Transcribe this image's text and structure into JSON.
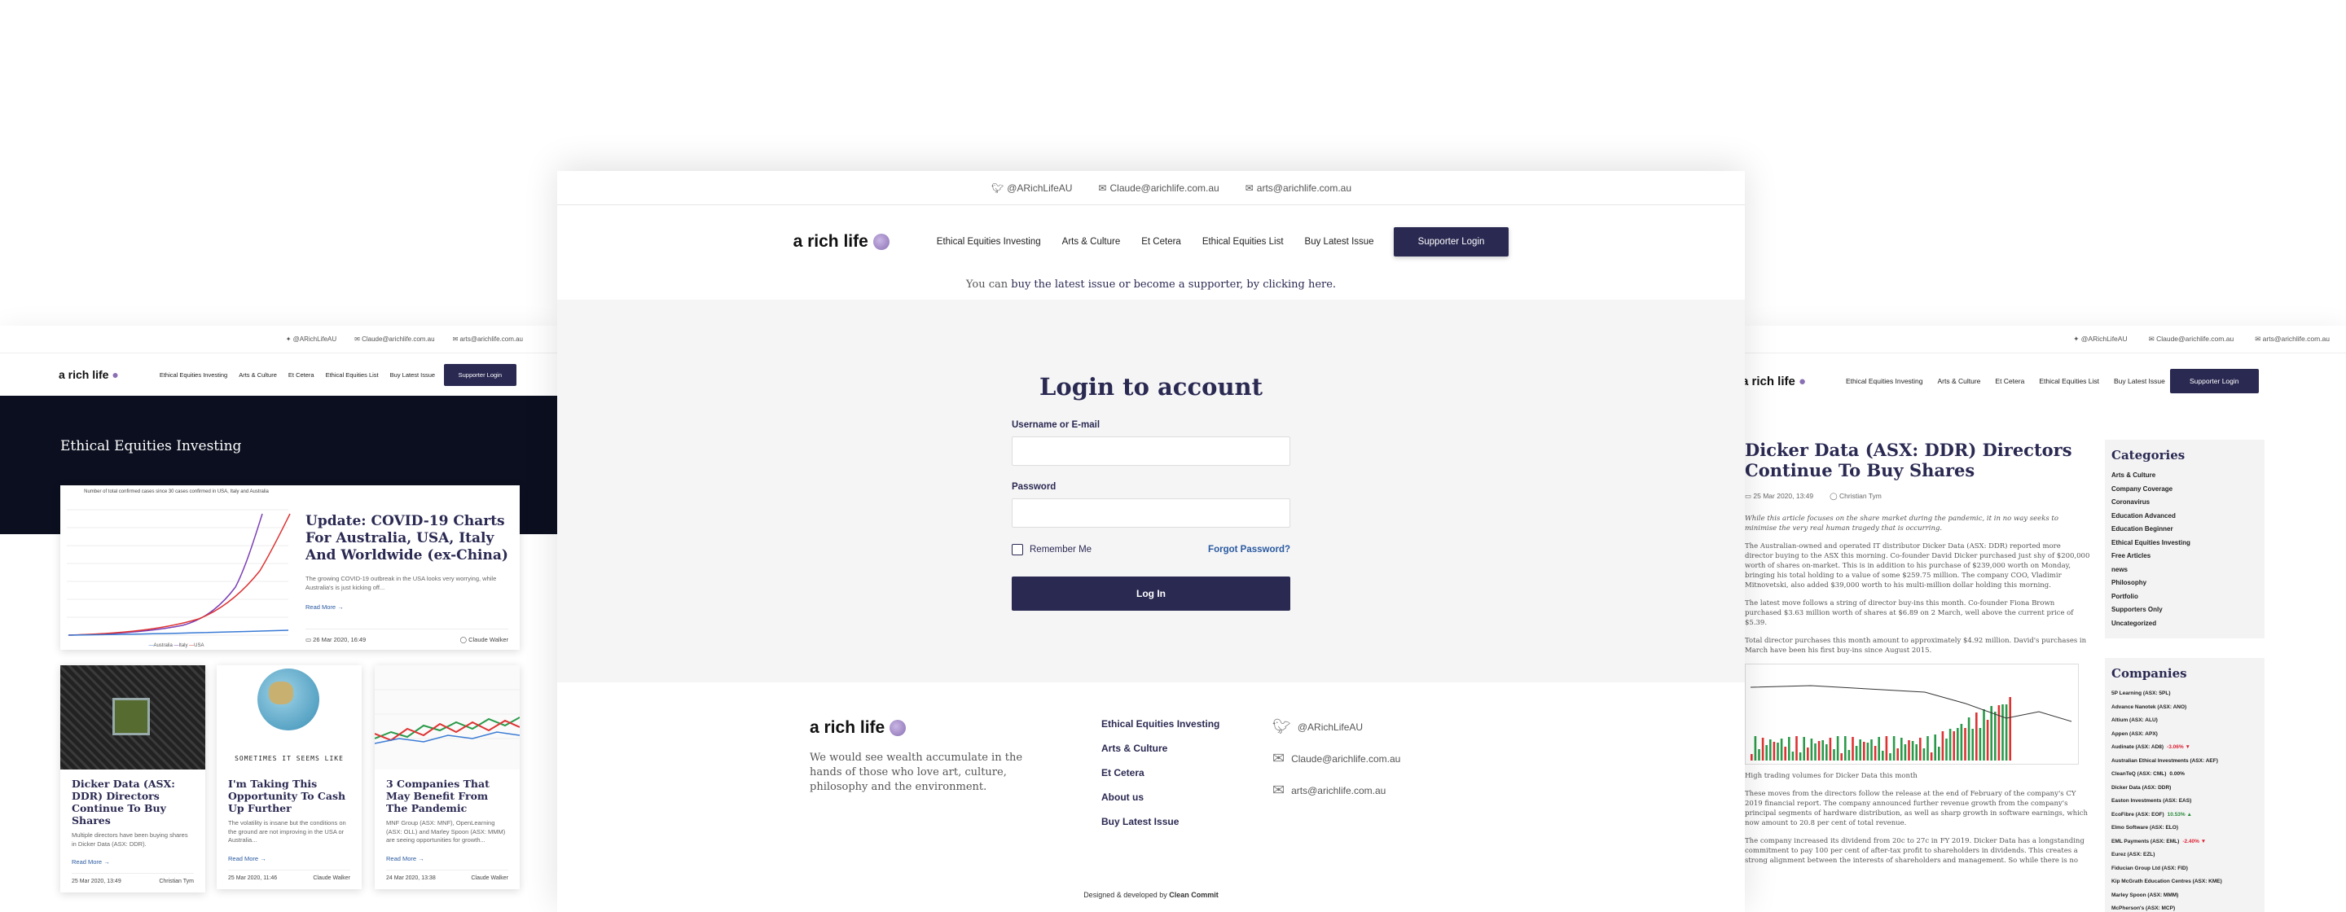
{
  "topbar": {
    "twitter": "@ARichLifeAU",
    "email1": "Claude@arichlife.com.au",
    "email2": "arts@arichlife.com.au"
  },
  "brand": {
    "logo_text": "a rich life"
  },
  "nav": {
    "items": [
      "Ethical Equities Investing",
      "Arts & Culture",
      "Et Cetera",
      "Ethical Equities List",
      "Buy Latest Issue"
    ],
    "supporter_login": "Supporter Login"
  },
  "notice": {
    "pre": "You can",
    "link": "buy the latest issue or become a supporter, by clicking here."
  },
  "login": {
    "title": "Login to account",
    "username_label": "Username or E-mail",
    "password_label": "Password",
    "remember_label": "Remember Me",
    "forgot_label": "Forgot Password?",
    "button_label": "Log In"
  },
  "footer": {
    "tagline": "We would see wealth accumulate in the hands of those who love art, culture, philosophy and the environment.",
    "links": [
      "Ethical Equities Investing",
      "Arts & Culture",
      "Et Cetera",
      "About us",
      "Buy Latest Issue"
    ],
    "credit_prefix": "Designed & developed by",
    "credit_name": "Clean Commit"
  },
  "left_page": {
    "hero_title": "Ethical Equities Investing",
    "featured": {
      "title": "Update: COVID-19 Charts For Australia, USA, Italy And Worldwide (ex-China)",
      "excerpt": "The growing COVID-19 outbreak in the USA looks very worrying, while Australia's is just kicking off...",
      "read_more": "Read More",
      "date": "26 Mar 2020, 16:49",
      "author": "Claude Walker",
      "chart_title": "Number of total confirmed cases since 30 cases confirmed in USA, Italy and Australia",
      "legend": [
        "Australia",
        "Italy",
        "USA"
      ]
    },
    "cards": [
      {
        "title": "Dicker Data (ASX: DDR) Directors Continue To Buy Shares",
        "excerpt": "Multiple directors have been buying shares in Dicker Data (ASX: DDR).",
        "read_more": "Read More",
        "date": "25 Mar 2020, 13:49",
        "author": "Christian Tym"
      },
      {
        "title": "I'm Taking This Opportunity To Cash Up Further",
        "excerpt": "The volatility is insane but the conditions on the ground are not improving in the USA or Australia...",
        "read_more": "Read More",
        "date": "25 Mar 2020, 11:46",
        "author": "Claude Walker",
        "image_caption": "SOMETIMES IT SEEMS LIKE"
      },
      {
        "title": "3 Companies That May Benefit From The Pandemic",
        "excerpt": "MNF Group (ASX: MNF), OpenLearning (ASX: OLL) and Marley Spoon (ASX: MMM) are seeing opportunities for growth...",
        "read_more": "Read More",
        "date": "24 Mar 2020, 13:38",
        "author": "Claude Walker"
      }
    ]
  },
  "right_page": {
    "article": {
      "title": "Dicker Data (ASX: DDR) Directors Continue To Buy Shares",
      "date": "25 Mar 2020, 13:49",
      "author": "Christian Tym",
      "intro": "While this article focuses on the share market during the pandemic, it in no way seeks to minimise the very real human tragedy that is occurring.",
      "p1": "The Australian-owned and operated IT distributor Dicker Data (ASX: DDR) reported more director buying to the ASX this morning. Co-founder David Dicker purchased just shy of $200,000 worth of shares on-market. This is in addition to his purchase of $239,000 worth on Monday, bringing his total holding to a value of some $259.75 million. The company COO, Vladimir Mitnovetski, also added $39,000 worth to his multi-million dollar holding this morning.",
      "p2": "The latest move follows a string of director buy-ins this month. Co-founder Fiona Brown purchased $3.63 million worth of shares at $6.89 on 2 March, well above the current price of $5.39.",
      "p3": "Total director purchases this month amount to approximately $4.92 million. David's purchases in March have been his first buy-ins since August 2015.",
      "chart_caption": "High trading volumes for Dicker Data this month",
      "p4": "These moves from the directors follow the release at the end of February of the company's CY 2019 financial report. The company announced further revenue growth from the company's principal segments of hardware distribution, as well as sharp growth in software earnings, which now amount to 20.8 per cent of total revenue.",
      "p5": "The company increased its dividend from 20c to 27c in FY 2019. Dicker Data has a longstanding commitment to pay 100 per cent of after-tax profit to shareholders in dividends. This creates a strong alignment between the interests of shareholders and management. So while there is no"
    },
    "categories": {
      "title": "Categories",
      "items": [
        "Arts & Culture",
        "Company Coverage",
        "Coronavirus",
        "Education Advanced",
        "Education Beginner",
        "Ethical Equities Investing",
        "Free Articles",
        "news",
        "Philosophy",
        "Portfolio",
        "Supporters Only",
        "Uncategorized"
      ]
    },
    "companies": {
      "title": "Companies",
      "items": [
        {
          "name": "5P Learning (ASX: 5PL)",
          "change": ""
        },
        {
          "name": "Advance Nanotek (ASX: ANO)",
          "change": ""
        },
        {
          "name": "Altium (ASX: ALU)",
          "change": ""
        },
        {
          "name": "Appen (ASX: APX)",
          "change": ""
        },
        {
          "name": "Audinate (ASX: AD8)",
          "change": "-3.06% ▼",
          "dir": "dn"
        },
        {
          "name": "Australian Ethical Investments (ASX: AEF)",
          "change": ""
        },
        {
          "name": "CleanTeQ (ASX: CML)",
          "change": "0.00%",
          "dir": "nc"
        },
        {
          "name": "Dicker Data (ASX: DDR)",
          "change": ""
        },
        {
          "name": "Easton Investments (ASX: EAS)",
          "change": ""
        },
        {
          "name": "EcoFibre (ASX: EOF)",
          "change": "10.53% ▲",
          "dir": "up"
        },
        {
          "name": "Elmo Software (ASX: ELO)",
          "change": ""
        },
        {
          "name": "EML Payments (ASX: EML)",
          "change": "-2.40% ▼",
          "dir": "dn"
        },
        {
          "name": "Eurez (ASX: EZL)",
          "change": ""
        },
        {
          "name": "Fiducian Group Ltd (ASX: FID)",
          "change": ""
        },
        {
          "name": "Kip McGrath Education Centres (ASX: KME)",
          "change": ""
        },
        {
          "name": "Marley Spoon (ASX: MMM)",
          "change": ""
        },
        {
          "name": "McPherson's (ASX: MCP)",
          "change": ""
        }
      ]
    }
  },
  "colors": {
    "brand": "#2a2952",
    "link": "#2a5aa0",
    "hero_bg": "#0b0f1f"
  }
}
